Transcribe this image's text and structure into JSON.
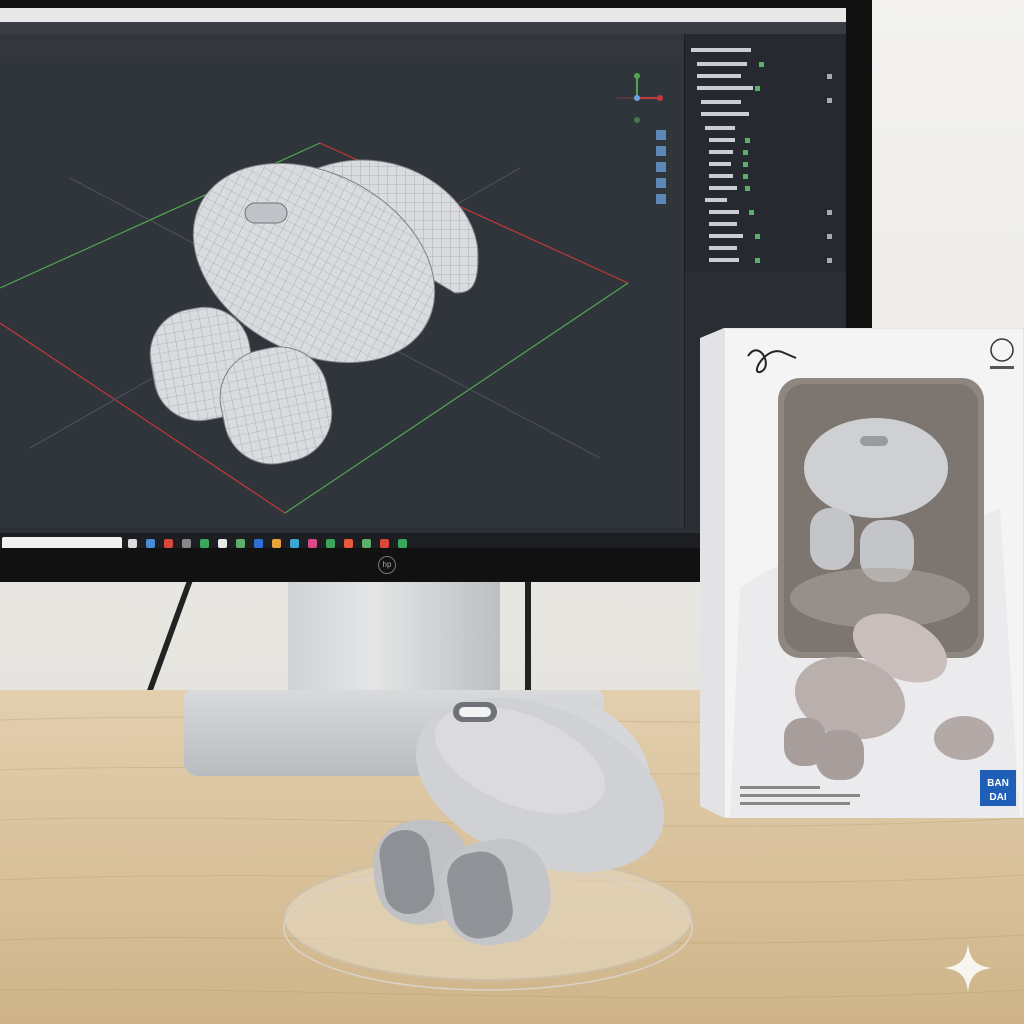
{
  "box": {
    "brand_logo": "BAN DAI",
    "signature": "Zibby"
  },
  "icons": {
    "windows_start": "start-icon",
    "search": "search-icon",
    "gizmo": "axis-gizmo-icon",
    "sparkle": "sparkle-icon"
  },
  "colors": {
    "viewport_bg": "#30343b",
    "grid_x": "#c0393b",
    "grid_y": "#4fa84f",
    "model": "#d8dadd",
    "desk": "#d7bf98"
  }
}
